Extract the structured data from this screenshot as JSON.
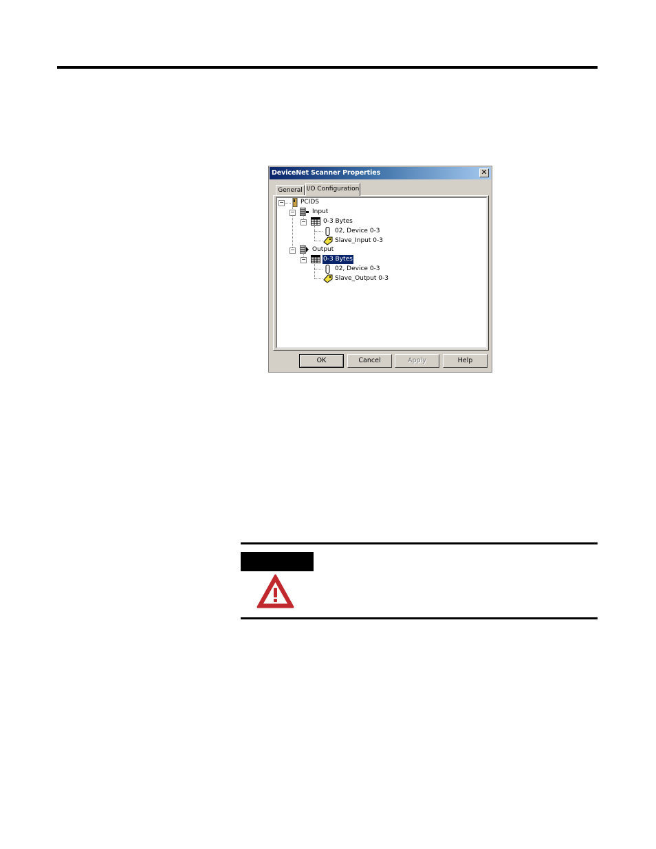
{
  "dialog": {
    "title": "DeviceNet Scanner Properties",
    "close_glyph": "✕",
    "tabs": [
      {
        "label": "General",
        "active": false
      },
      {
        "label": "I/O Configuration",
        "active": true
      }
    ],
    "tree": {
      "root": {
        "expander": "−",
        "label": "PCIDS"
      },
      "input": {
        "expander": "−",
        "label": "Input",
        "bytes": {
          "expander": "−",
          "label": "0-3 Bytes"
        },
        "device": {
          "label": "02, Device 0-3"
        },
        "slave": {
          "label": "Slave_Input 0-3"
        }
      },
      "output": {
        "expander": "−",
        "label": "Output",
        "bytes": {
          "expander": "−",
          "label": "0-3 Bytes",
          "selected": true
        },
        "device": {
          "label": "02, Device 0-3"
        },
        "slave": {
          "label": "Slave_Output 0-3"
        }
      }
    },
    "buttons": {
      "ok": "OK",
      "cancel": "Cancel",
      "apply": "Apply",
      "help": "Help"
    },
    "colors": {
      "title_bar_start": "#0a246a",
      "title_bar_end": "#a6caf0",
      "face": "#d4d0c8",
      "selection": "#0a246a"
    }
  },
  "warning": {
    "icon": "warning-triangle-icon",
    "color": "#c0282d"
  }
}
